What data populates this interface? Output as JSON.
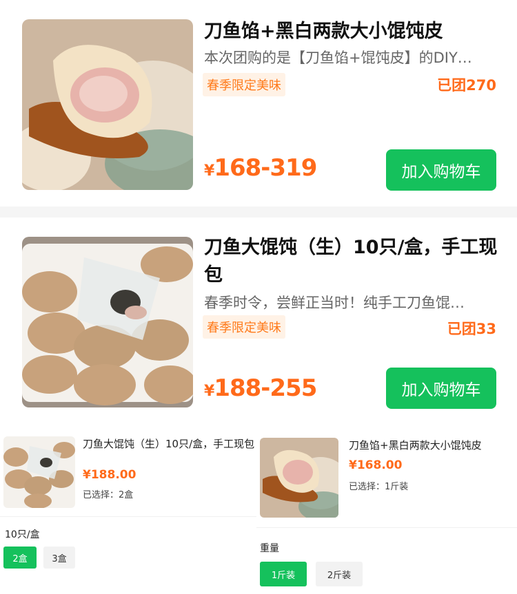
{
  "products": [
    {
      "title": "刀鱼馅+黑白两款大小馄饨皮",
      "desc": "本次团购的是【刀鱼馅+馄饨皮】的DIY…",
      "tag": "春季限定美味",
      "sold": "已团270",
      "price_symbol": "¥",
      "price_range": "168-319",
      "cart_label": "加入购物车"
    },
    {
      "title": "刀鱼大馄饨（生）10只/盒，手工现包",
      "desc": "春季时令，尝鲜正当时！纯手工刀鱼馄…",
      "tag": "春季限定美味",
      "sold": "已团33",
      "price_symbol": "¥",
      "price_range": "188-255",
      "cart_label": "加入购物车"
    }
  ],
  "popup_a": {
    "name": "刀鱼大馄饨（生）10只/盒，手工现包",
    "price": "¥188.00",
    "selected": "已选择：2盒",
    "spec_label": "10只/盒",
    "options": [
      "2盒",
      "3盒"
    ],
    "selected_option": "2盒"
  },
  "popup_b": {
    "name": "刀鱼馅+黑白两款大小馄饨皮",
    "price": "¥168.00",
    "selected": "已选择：1斤装",
    "spec_label": "重量",
    "options": [
      "1斤装",
      "2斤装"
    ],
    "selected_option": "1斤装"
  },
  "colors": {
    "accent_green": "#15c15c",
    "price_orange": "#ff6a1a",
    "tag_bg": "#fff2e6"
  }
}
